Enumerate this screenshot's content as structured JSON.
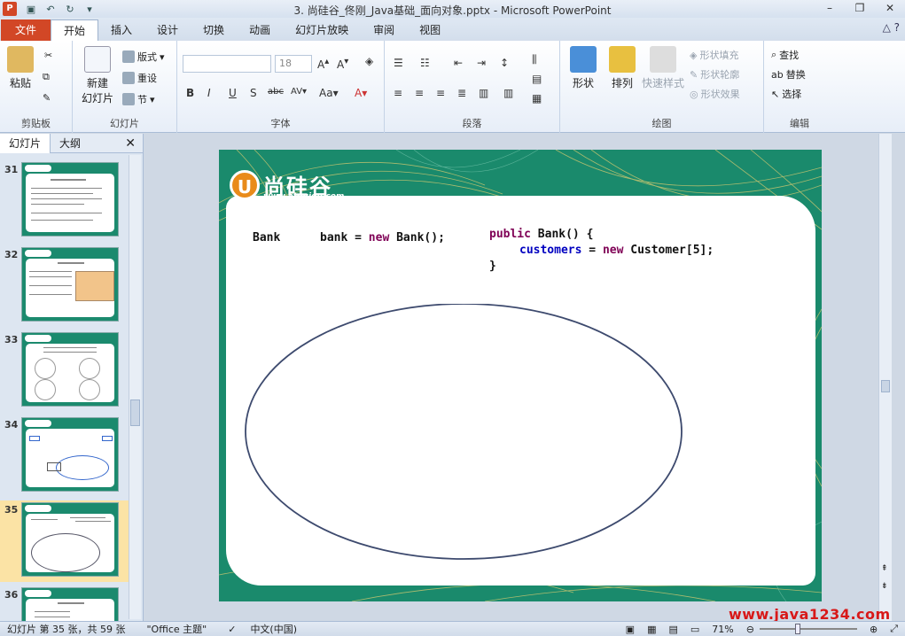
{
  "window": {
    "title": "3. 尚硅谷_佟刚_Java基础_面向对象.pptx - Microsoft PowerPoint",
    "app_letter": "P"
  },
  "tabs": [
    "文件",
    "开始",
    "插入",
    "设计",
    "切换",
    "动画",
    "幻灯片放映",
    "审阅",
    "视图"
  ],
  "active_tab": "开始",
  "ribbon": {
    "clipboard": {
      "label": "剪贴板",
      "paste": "粘贴"
    },
    "slides": {
      "label": "幻灯片",
      "new_slide": "新建",
      "new_slide2": "幻灯片",
      "layout": "版式",
      "reset": "重设",
      "section": "节"
    },
    "font": {
      "label": "字体",
      "size": "18"
    },
    "paragraph": {
      "label": "段落"
    },
    "drawing": {
      "label": "绘图",
      "shape": "形状",
      "arrange": "排列",
      "quick_styles": "快速样式",
      "shape_fill": "形状填充",
      "shape_outline": "形状轮廓",
      "shape_effects": "形状效果"
    },
    "editing": {
      "label": "编辑",
      "find": "查找",
      "replace": "替换",
      "select": "选择"
    }
  },
  "left_pane": {
    "tabs": [
      "幻灯片",
      "大纲"
    ],
    "thumbnails": [
      {
        "num": "31"
      },
      {
        "num": "32"
      },
      {
        "num": "33"
      },
      {
        "num": "34"
      },
      {
        "num": "35"
      },
      {
        "num": "36"
      }
    ],
    "selected": "35"
  },
  "slide": {
    "logo_text": "尚硅谷",
    "logo_letter": "U",
    "logo_url": "www.atguigu.com",
    "code_left_type": "Bank",
    "code_left_stmt": "bank = new Bank();",
    "code_right_line1": "public Bank() {",
    "code_right_line2": "customers = new Customer[5];",
    "code_right_line3": "}"
  },
  "status": {
    "slide_info": "幻灯片 第 35 张，共 59 张",
    "theme": "\"Office 主题\"",
    "language": "中文(中国)",
    "zoom": "71%"
  },
  "watermark": "www.java1234.com",
  "colors": {
    "file_tab": "#d24726",
    "slide_green": "#1a8a6c",
    "accent_orange": "#e98b1a"
  }
}
